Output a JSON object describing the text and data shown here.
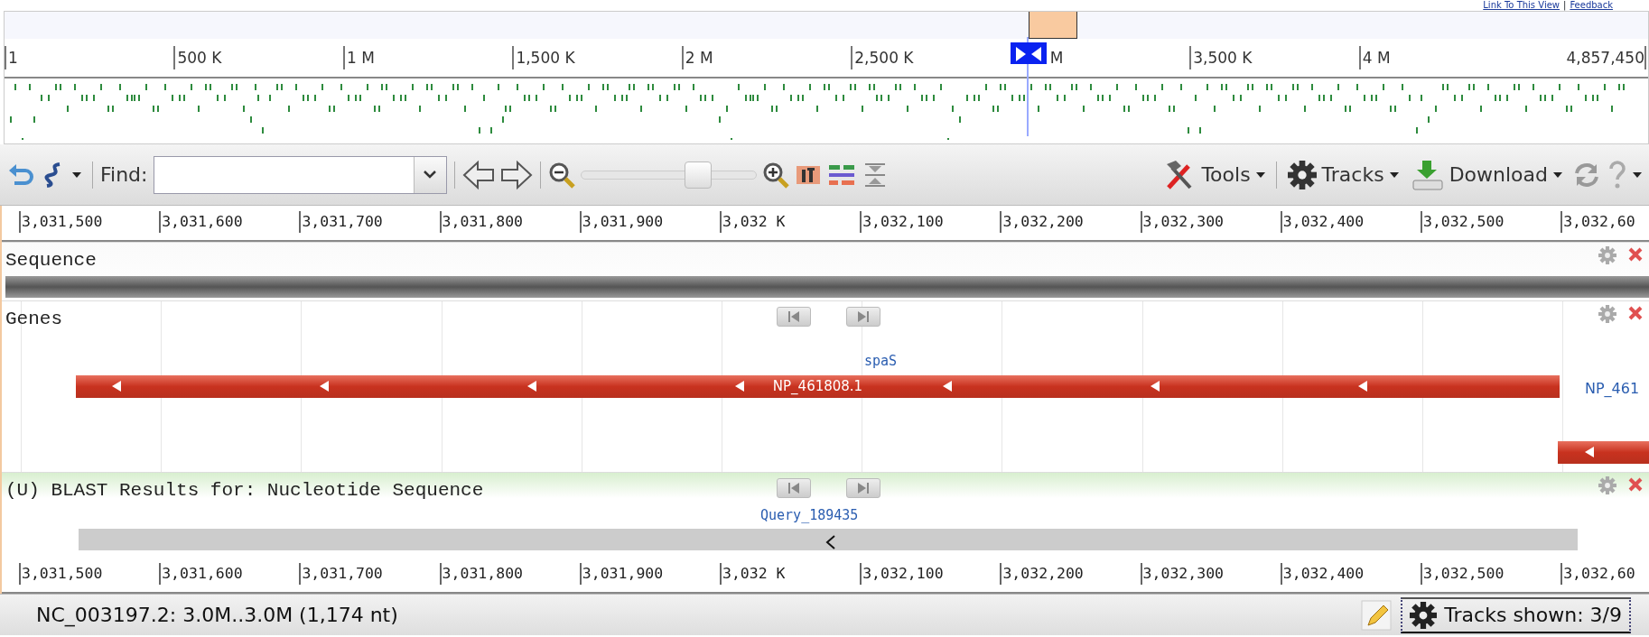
{
  "header_links": {
    "links": [
      "Link To This View",
      "Feedback"
    ],
    "separator": "|"
  },
  "overview": {
    "ruler_labels": [
      "1",
      "500 K",
      "1 M",
      "1,500 K",
      "2 M",
      "2,500 K",
      "M",
      "3,500 K",
      "4 M",
      "4,857,450"
    ],
    "view_marker": {
      "level": 0.624
    }
  },
  "toolbar": {
    "find_label": "Find:",
    "menus": [
      "Tools",
      "Tracks",
      "Download"
    ],
    "zoom_slider": {
      "level": 0.67
    }
  },
  "ruler_labels": [
    "3,031,500",
    "3,031,600",
    "3,031,700",
    "3,031,800",
    "3,031,900",
    "3,032 K",
    "3,032,100",
    "3,032,200",
    "3,032,300",
    "3,032,400",
    "3,032,500",
    "3,032,60"
  ],
  "tracks": [
    {
      "kind": "sequence",
      "label": "Sequence"
    },
    {
      "kind": "genes",
      "label": "Genes",
      "gene_name": "spaS",
      "feature_label": "NP_461808.1",
      "next_feature_label": "NP_461"
    },
    {
      "kind": "blast",
      "label": "(U) BLAST Results for: Nucleotide Sequence",
      "hit_label": "Query_189435"
    }
  ],
  "bottom_ruler_labels": [
    "3,031,500",
    "3,031,600",
    "3,031,700",
    "3,031,800",
    "3,031,900",
    "3,032 K",
    "3,032,100",
    "3,032,200",
    "3,032,300",
    "3,032,400",
    "3,032,500",
    "3,032,60"
  ],
  "status_bar": {
    "location": "NC_003197.2: 3.0M..3.0M (1,174 nt)",
    "tracks_shown": "Tracks shown: 3/9"
  }
}
